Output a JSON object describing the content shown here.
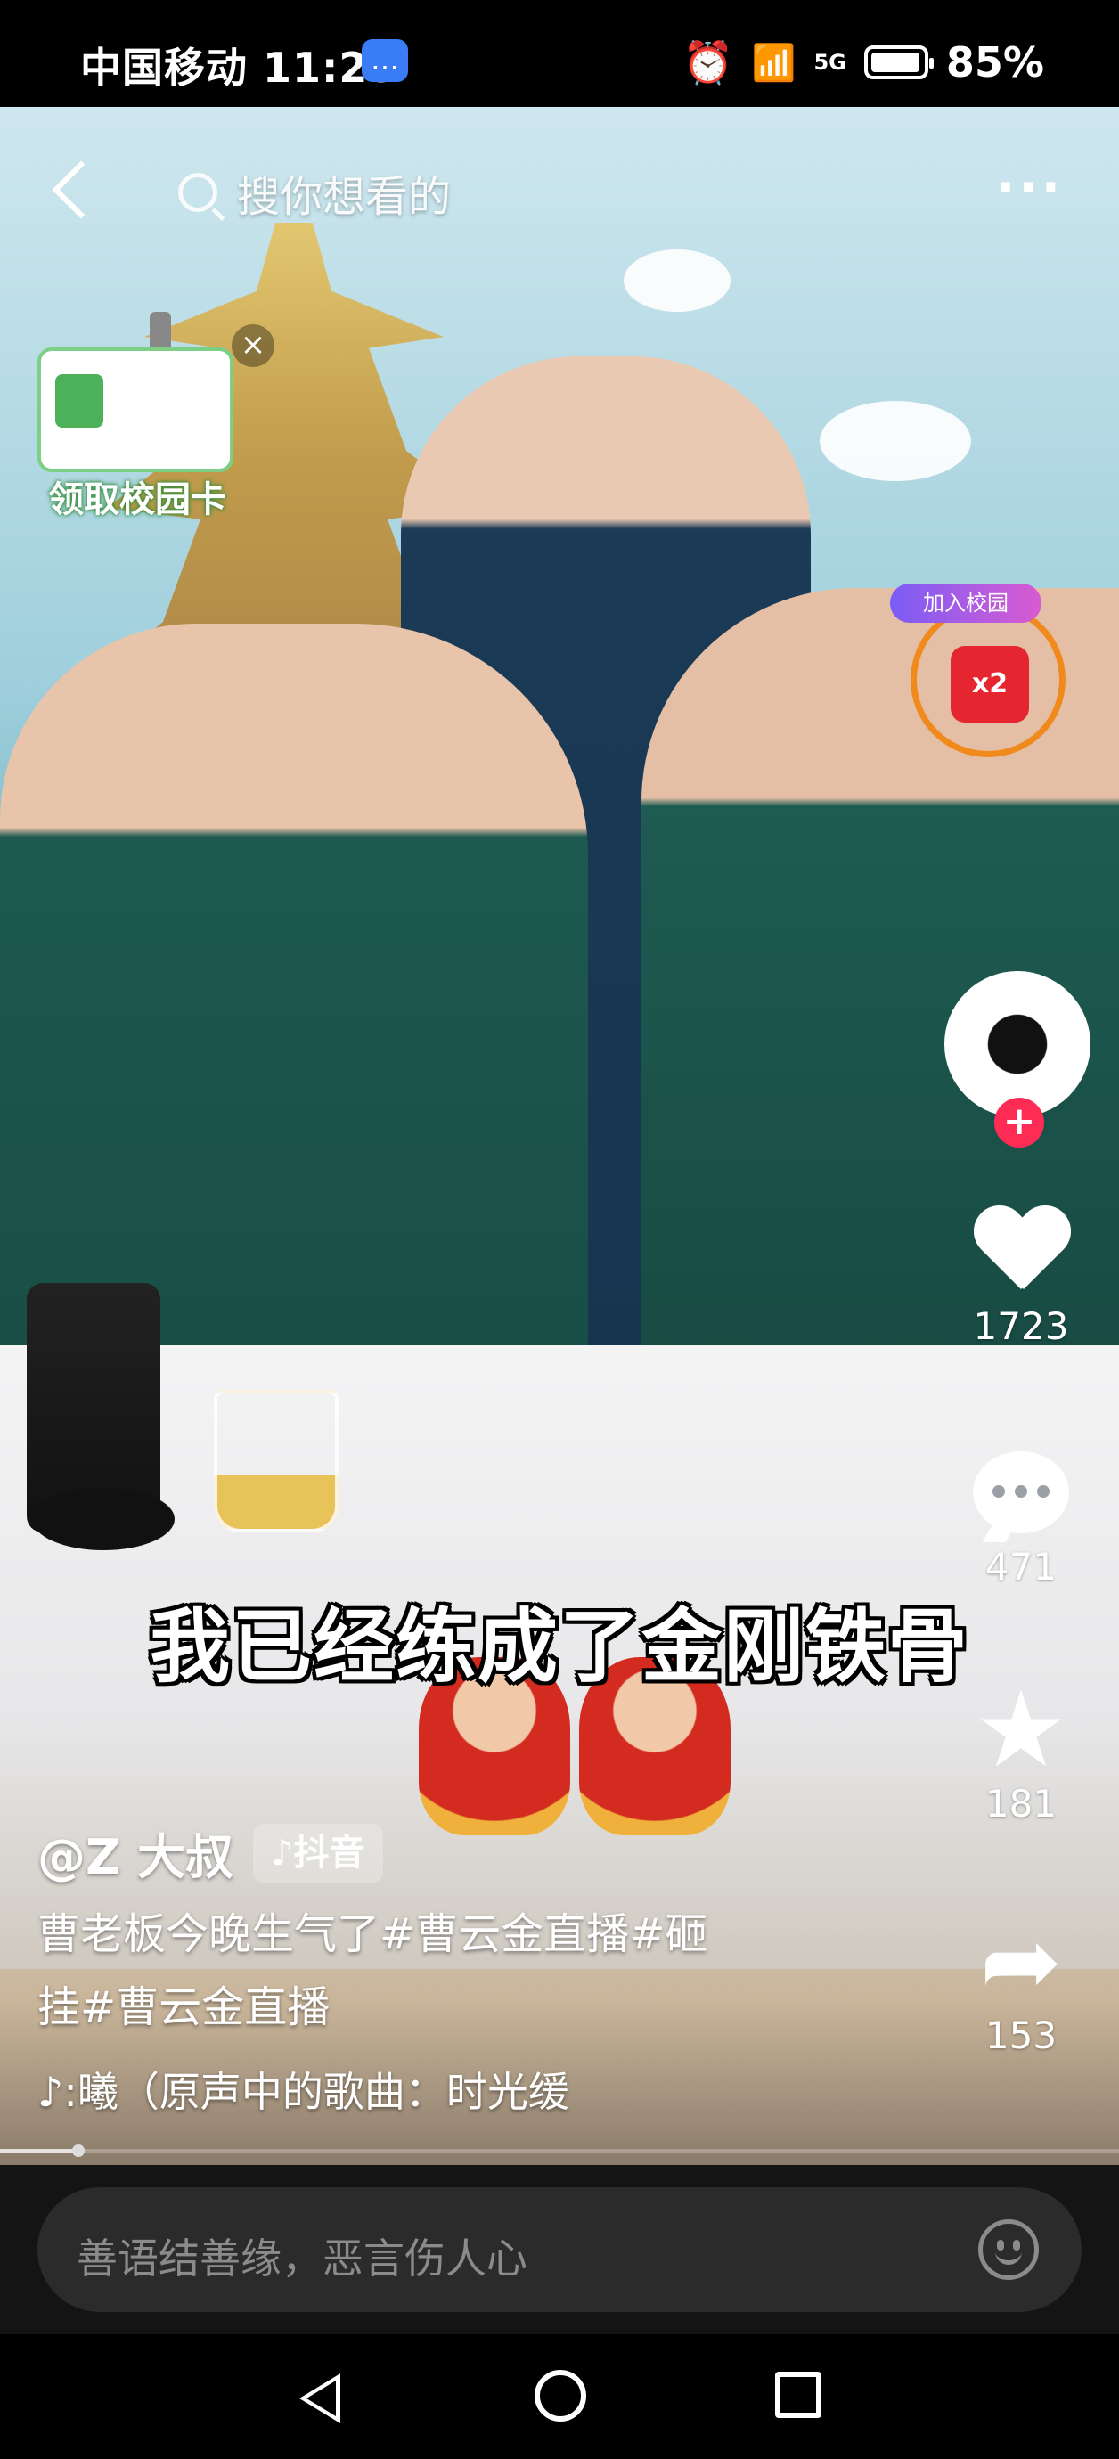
{
  "status_bar": {
    "carrier_time": "中国移动 11:25",
    "battery": "85%",
    "network": "5G"
  },
  "top": {
    "search_placeholder": "搜你想看的",
    "more": "···"
  },
  "campus_card": {
    "label": "领取校园卡",
    "close": "×"
  },
  "red_packet": {
    "badge": "x2",
    "tag": "加入校园"
  },
  "actions": {
    "likes": "1723",
    "comments": "471",
    "favorites": "181",
    "shares": "153",
    "follow": "+"
  },
  "subtitle": "我已经练成了金刚铁骨",
  "caption": {
    "author": "@Z 大叔",
    "platform_tag": "♪抖音",
    "description_line1": "曹老板今晚生气了#曹云金直播#砸",
    "description_line2": "挂#曹云金直播",
    "music": "♪:曦（原声中的歌曲：时光缓"
  },
  "progress": {
    "fraction": 0.07
  },
  "comment": {
    "placeholder": "善语结善缘，恶言伤人心"
  },
  "colors": {
    "accent_red": "#fe2c55",
    "redpacket_ring": "#f08a1c"
  }
}
